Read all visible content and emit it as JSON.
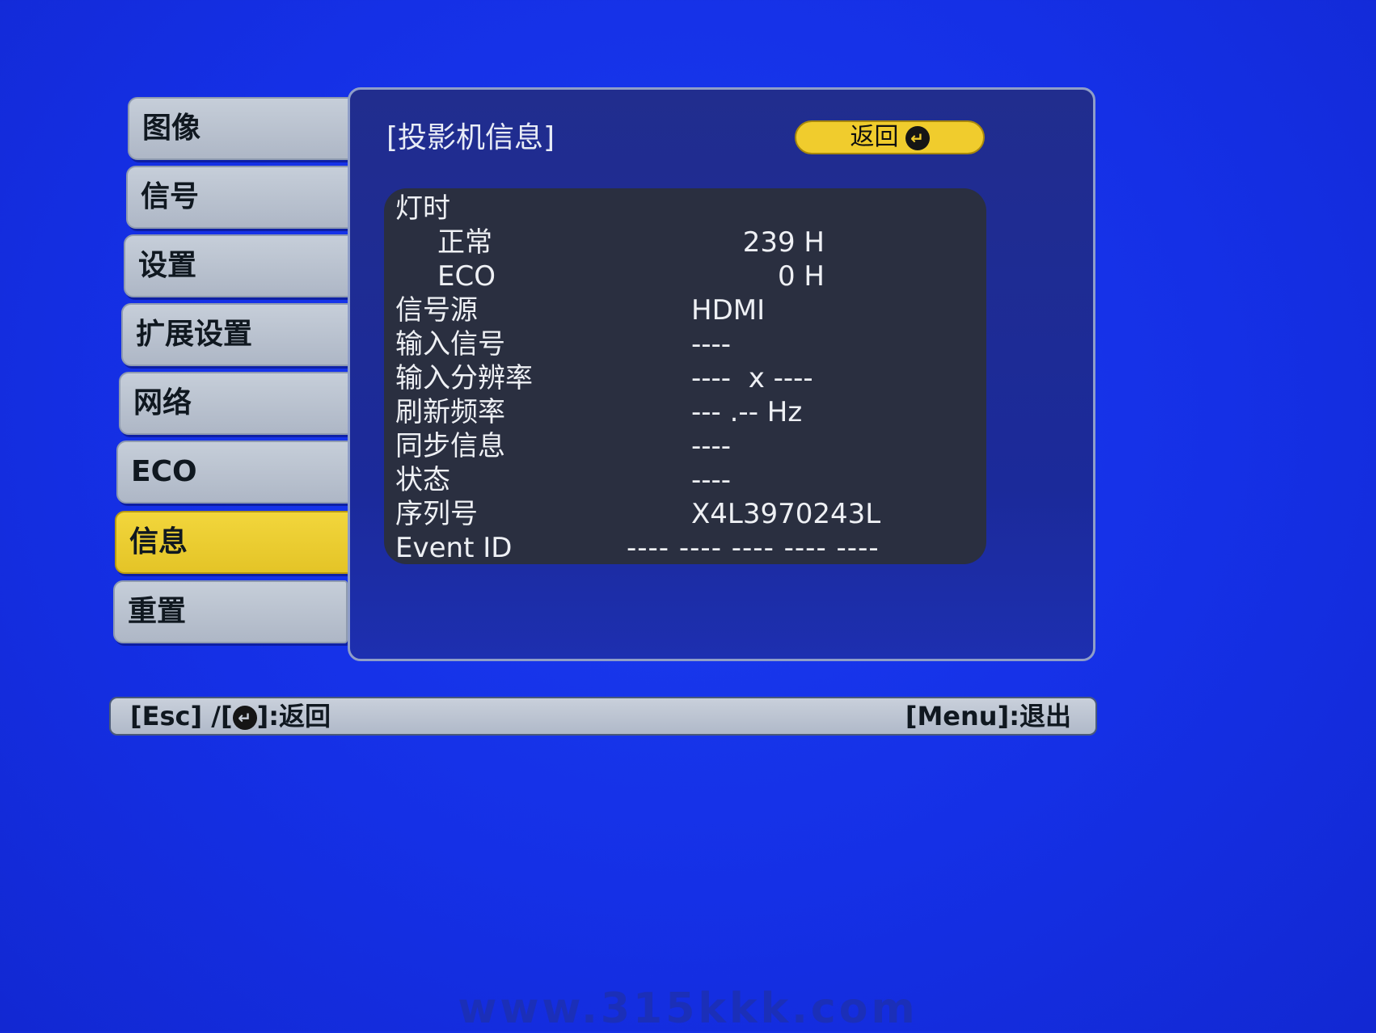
{
  "sidebar": {
    "items": [
      {
        "label": "图像"
      },
      {
        "label": "信号"
      },
      {
        "label": "设置"
      },
      {
        "label": "扩展设置"
      },
      {
        "label": "网络"
      },
      {
        "label": "ECO"
      },
      {
        "label": "信息",
        "selected": true
      },
      {
        "label": "重置"
      }
    ]
  },
  "panel": {
    "title": "[投影机信息]",
    "back_button": "返回",
    "back_icon": "enter-icon"
  },
  "info": {
    "lamp_hours": {
      "label": "灯时"
    },
    "normal": {
      "label": "正常",
      "value": "239 H"
    },
    "eco": {
      "label": "ECO",
      "value": "0 H"
    },
    "source": {
      "label": "信号源",
      "value": "HDMI"
    },
    "input_signal": {
      "label": "输入信号",
      "value": "----"
    },
    "resolution": {
      "label": "输入分辨率",
      "value": "----  x ----"
    },
    "refresh_rate": {
      "label": "刷新频率",
      "value": "--- .-- Hz"
    },
    "sync_info": {
      "label": "同步信息",
      "value": "----"
    },
    "status": {
      "label": "状态",
      "value": "----"
    },
    "serial": {
      "label": "序列号",
      "value": "X4L3970243L"
    },
    "event_id": {
      "label": "Event ID",
      "value": "---- ---- ---- ---- ----"
    }
  },
  "help_bar": {
    "left_prefix": "[Esc] /[",
    "left_suffix": "]:返回",
    "right": "[Menu]:退出"
  },
  "watermark": "www.315kkk.com",
  "colors": {
    "background": "#1530e6",
    "panel": "#1b2a9a",
    "info_box": "#2a2f40",
    "highlight": "#f0cc2d",
    "menu_item": "#b8c0ce"
  }
}
